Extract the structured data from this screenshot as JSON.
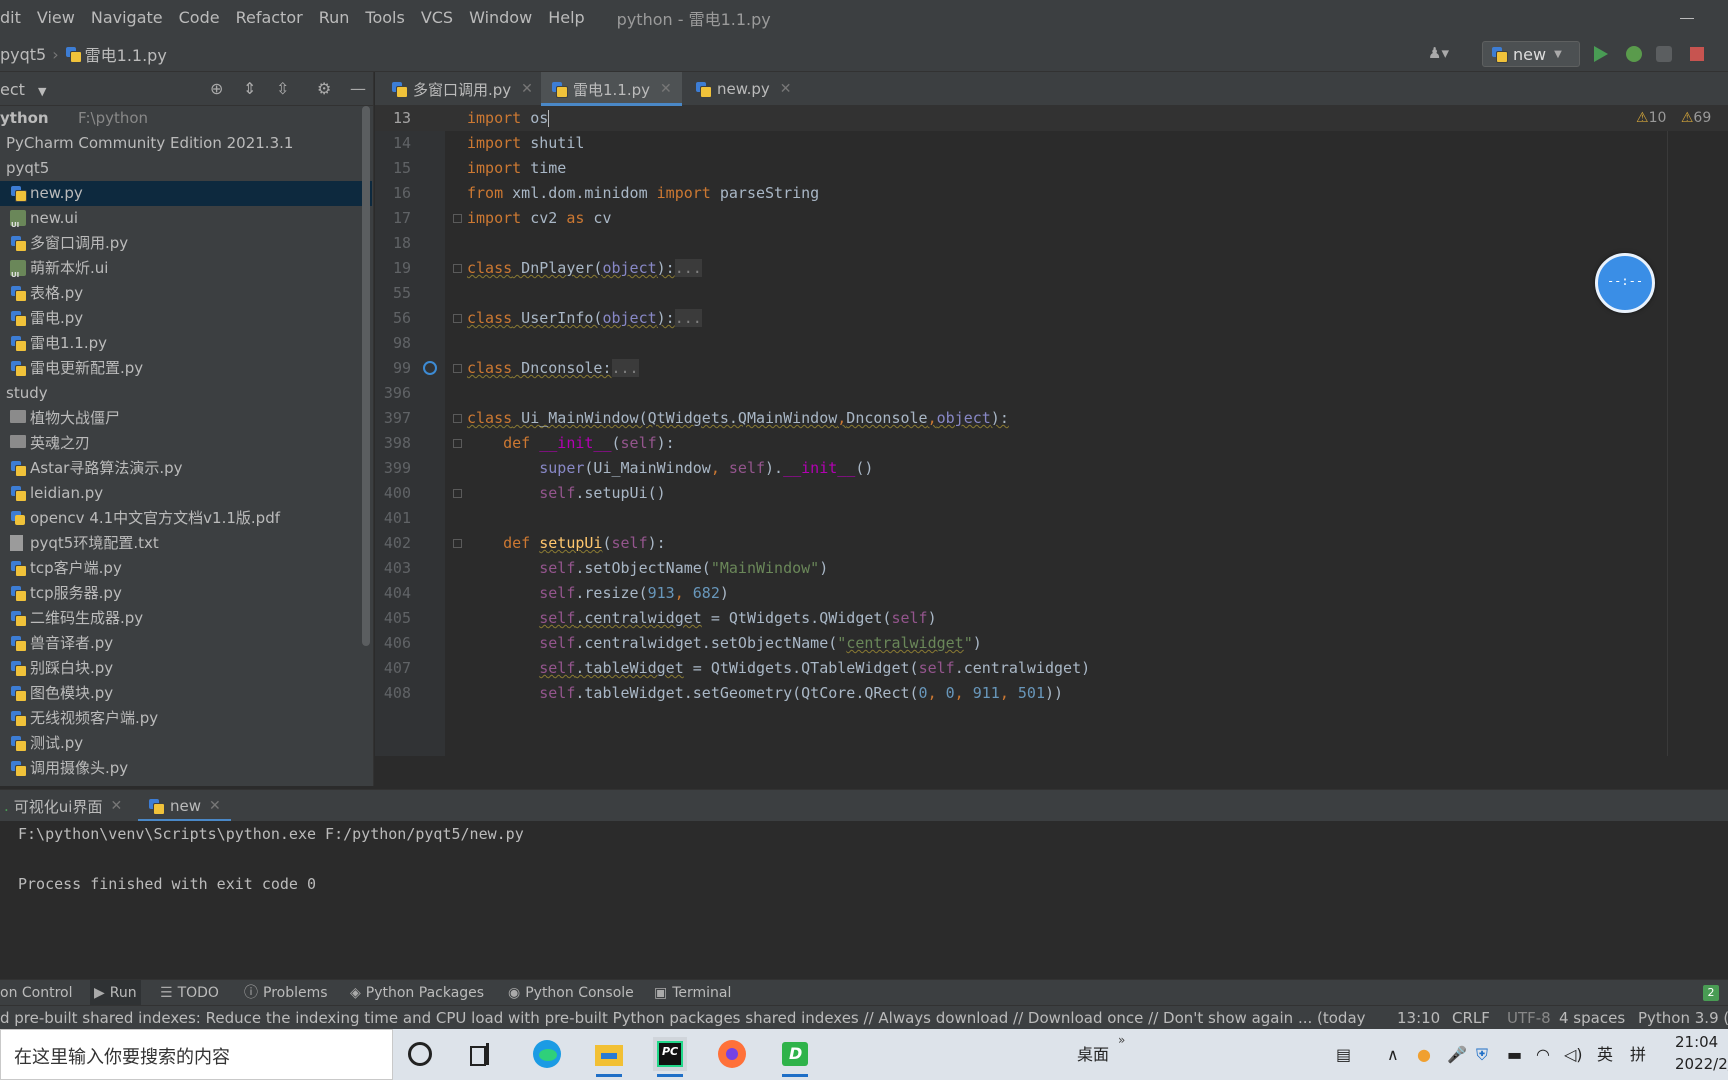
{
  "menubar": {
    "items": [
      "dit",
      "View",
      "Navigate",
      "Code",
      "Refactor",
      "Run",
      "Tools",
      "VCS",
      "Window",
      "Help"
    ],
    "window_title": "python - 雷电1.1.py"
  },
  "breadcrumb": {
    "project": "pyqt5",
    "file": "雷电1.1.py"
  },
  "run_config": {
    "name": "new"
  },
  "project_panel": {
    "header": "ect",
    "tree": [
      {
        "label": "ython",
        "path": "F:\\python",
        "indent": 0,
        "icon": "none",
        "bold": true
      },
      {
        "label": "PyCharm Community Edition 2021.3.1",
        "indent": 0,
        "icon": "none"
      },
      {
        "label": "pyqt5",
        "indent": 0,
        "icon": "none"
      },
      {
        "label": "new.py",
        "indent": 1,
        "icon": "python-file-icon",
        "selected": true
      },
      {
        "label": "new.ui",
        "indent": 1,
        "icon": "ui-file-icon"
      },
      {
        "label": "多窗口调用.py",
        "indent": 1,
        "icon": "python-file-icon"
      },
      {
        "label": "萌新本炘.ui",
        "indent": 1,
        "icon": "ui-file-icon"
      },
      {
        "label": "表格.py",
        "indent": 1,
        "icon": "python-file-icon"
      },
      {
        "label": "雷电.py",
        "indent": 1,
        "icon": "python-file-icon"
      },
      {
        "label": "雷电1.1.py",
        "indent": 1,
        "icon": "python-file-icon"
      },
      {
        "label": "雷电更新配置.py",
        "indent": 1,
        "icon": "python-file-icon"
      },
      {
        "label": "study",
        "indent": 0,
        "icon": "none"
      },
      {
        "label": "植物大战僵尸",
        "indent": 1,
        "icon": "folder-icon"
      },
      {
        "label": "英魂之刃",
        "indent": 1,
        "icon": "folder-icon"
      },
      {
        "label": "Astar寻路算法演示.py",
        "indent": 1,
        "icon": "python-file-icon"
      },
      {
        "label": "leidian.py",
        "indent": 1,
        "icon": "python-file-icon"
      },
      {
        "label": "opencv 4.1中文官方文档v1.1版.pdf",
        "indent": 1,
        "icon": "pdf-file-icon"
      },
      {
        "label": "pyqt5环境配置.txt",
        "indent": 1,
        "icon": "text-file-icon"
      },
      {
        "label": "tcp客户端.py",
        "indent": 1,
        "icon": "python-file-icon"
      },
      {
        "label": "tcp服务器.py",
        "indent": 1,
        "icon": "python-file-icon"
      },
      {
        "label": "二维码生成器.py",
        "indent": 1,
        "icon": "python-file-icon"
      },
      {
        "label": "兽音译者.py",
        "indent": 1,
        "icon": "python-file-icon"
      },
      {
        "label": "别踩白块.py",
        "indent": 1,
        "icon": "python-file-icon"
      },
      {
        "label": "图色模块.py",
        "indent": 1,
        "icon": "python-file-icon"
      },
      {
        "label": "无线视频客户端.py",
        "indent": 1,
        "icon": "python-file-icon"
      },
      {
        "label": "测试.py",
        "indent": 1,
        "icon": "python-file-icon"
      },
      {
        "label": "调用摄像头.py",
        "indent": 1,
        "icon": "python-file-icon"
      }
    ]
  },
  "editor_tabs": [
    {
      "label": "多窗口调用.py",
      "active": false
    },
    {
      "label": "雷电1.1.py",
      "active": true
    },
    {
      "label": "new.py",
      "active": false
    }
  ],
  "editor": {
    "warnings": "10",
    "weak_warnings": "69",
    "line_numbers": [
      "13",
      "14",
      "15",
      "16",
      "17",
      "18",
      "19",
      "55",
      "56",
      "98",
      "99",
      "396",
      "397",
      "398",
      "399",
      "400",
      "401",
      "402",
      "403",
      "404",
      "405",
      "406",
      "407",
      "408"
    ]
  },
  "floating_widget": {
    "text": "--:--"
  },
  "run_panel": {
    "tabs": [
      {
        "label": "可视化ui界面"
      },
      {
        "label": "new"
      }
    ],
    "output": [
      "F:\\python\\venv\\Scripts\\python.exe F:/python/pyqt5/new.py",
      "",
      "Process finished with exit code 0"
    ]
  },
  "tool_windows": [
    "on Control",
    "Run",
    "TODO",
    "Problems",
    "Python Packages",
    "Python Console",
    "Terminal"
  ],
  "event_log_count": "2",
  "statusbar": {
    "message": "d pre-built shared indexes: Reduce the indexing time and CPU load with pre-built Python packages shared indexes // Always download // Download once // Don't show again ... (today 19:5",
    "position": "13:10",
    "line_sep": "CRLF",
    "encoding": "UTF-8",
    "indent": "4 spaces",
    "interpreter": "Python 3.9 (p"
  },
  "taskbar": {
    "search_placeholder": "在这里输入你要搜索的内容",
    "desktop_label": "桌面",
    "ime_lang": "英",
    "ime_mode": "拼",
    "time": "21:04",
    "date": "2022/2/"
  }
}
